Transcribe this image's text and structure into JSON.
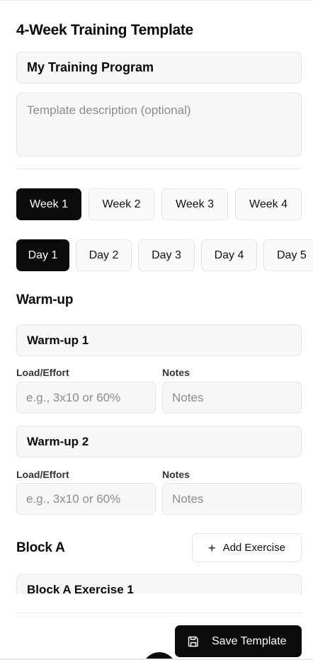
{
  "page": {
    "title": "4-Week Training Template",
    "name_value": "My Training Program",
    "description_placeholder": "Template description (optional)"
  },
  "weeks": [
    {
      "label": "Week 1",
      "active": true
    },
    {
      "label": "Week 2",
      "active": false
    },
    {
      "label": "Week 3",
      "active": false
    },
    {
      "label": "Week 4",
      "active": false
    }
  ],
  "days": [
    {
      "label": "Day 1",
      "active": true
    },
    {
      "label": "Day 2",
      "active": false
    },
    {
      "label": "Day 3",
      "active": false
    },
    {
      "label": "Day 4",
      "active": false
    },
    {
      "label": "Day 5",
      "active": false
    }
  ],
  "warmup": {
    "title": "Warm-up",
    "exercises": [
      {
        "name": "Warm-up 1",
        "load_label": "Load/Effort",
        "load_placeholder": "e.g., 3x10 or 60%",
        "notes_label": "Notes",
        "notes_placeholder": "Notes"
      },
      {
        "name": "Warm-up 2",
        "load_label": "Load/Effort",
        "load_placeholder": "e.g., 3x10 or 60%",
        "notes_label": "Notes",
        "notes_placeholder": "Notes"
      }
    ]
  },
  "block_a": {
    "title": "Block A",
    "add_label": "Add Exercise",
    "first_exercise": "Block A Exercise 1"
  },
  "footer": {
    "save_label": "Save Template"
  },
  "icons": {
    "add": "plus-icon",
    "save": "save-icon"
  },
  "colors": {
    "accent": "#0b0b0b",
    "field_bg": "#f7f7f7",
    "border": "#e6e6e6"
  }
}
